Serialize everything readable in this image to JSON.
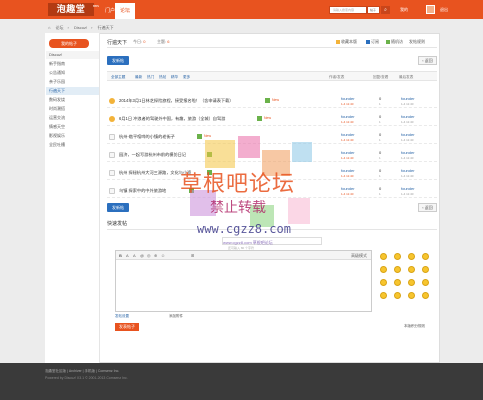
{
  "header": {
    "logo": "泡趣堂",
    "logo_sup": "BBS",
    "nav": [
      "门户",
      "论坛"
    ],
    "search_placeholder": "请输入搜索内容",
    "search_type": "帖子",
    "search_icon": "search-icon",
    "links": [
      "我的",
      "退出"
    ]
  },
  "breadcrumb": [
    "首页",
    "论坛",
    "Discuz!",
    "行遍天下"
  ],
  "sidebar": {
    "post_button": "我的帖子",
    "head": "Discuz!",
    "items": [
      "新手指南",
      "公告通知",
      "亲子乐园",
      "行遍天下",
      "数码发烧",
      "时尚潮搭",
      "运营交流",
      "情感天空",
      "影视娱乐",
      "全民吐槽"
    ],
    "active_index": 3
  },
  "main": {
    "title": "行遍天下",
    "today_label": "今日:",
    "today_count": "0",
    "topic_label": "主题:",
    "topic_count": "6",
    "right_links": [
      "收藏本版",
      "订阅",
      "随机访",
      "发帖规则"
    ],
    "new_post": "发新帖",
    "back": "返回",
    "filters": [
      "全部主题",
      "最新",
      "热门",
      "热帖",
      "精华",
      "更多"
    ],
    "col_author": "作者/发表",
    "col_replies": "回复/查看",
    "col_last": "最后发表"
  },
  "threads": [
    {
      "title": "2014年3月1日林芝探险旅程，接受报名啦！（含申请表下载）",
      "badge": true,
      "new": "New",
      "icon": "fire",
      "author": "founder",
      "date": "1-4 11:40",
      "replies": "0",
      "views": "1",
      "last": "founder",
      "last_date": "1-4 11:40"
    },
    {
      "title": "6月1日 冲浪者的驾驶外中国，有趣，旅游（全城）自驾游",
      "badge": true,
      "new": "New",
      "icon": "smile",
      "author": "founder",
      "date": "1-4 11:40",
      "replies": "0",
      "views": "1",
      "last": "founder",
      "last_date": "1-4 11:40"
    },
    {
      "title": "杭州-临平喧哗的小镇的老街子",
      "badge": true,
      "new": "New",
      "icon": "plain",
      "author": "founder",
      "date": "1-4 11:40",
      "replies": "0",
      "views": "1",
      "last": "founder",
      "last_date": "1-4 11:40"
    },
    {
      "title": "园济，一起写游杭州市前的模仿日记",
      "badge": true,
      "new": "",
      "icon": "plain",
      "author": "founder",
      "date": "1-4 11:40",
      "replies": "0",
      "views": "1",
      "last": "founder",
      "last_date": "1-4 11:40"
    },
    {
      "title": "杭州 探秘杭州大河三源路，文化与小资",
      "badge": true,
      "new": "",
      "icon": "plain",
      "author": "founder",
      "date": "1-4 11:40",
      "replies": "0",
      "views": "1",
      "last": "founder",
      "last_date": "1-4 11:40"
    },
    {
      "title": "乌镇 探索中的中外旅游地",
      "badge": true,
      "new": "",
      "icon": "plain",
      "author": "founder",
      "date": "1-4 11:40",
      "replies": "0",
      "views": "1",
      "last": "founder",
      "last_date": "1-4 11:40"
    }
  ],
  "quick_reply": {
    "title": "快速发帖",
    "subject_hint": "还可输入 80 个字符",
    "toolbar": [
      "B",
      "A",
      "A",
      "@",
      "◎",
      "⊕",
      "☺",
      "⊞"
    ],
    "mode": "高级模式",
    "bottom_left": "发帖设置",
    "bottom_mid": "添加附件",
    "submit": "发表帖子",
    "bottom_right": "本版积分规则"
  },
  "footer": {
    "line1": "泡趣堂社区版 | Archiver | 手机版 | Comsenz Inc.",
    "line2": "Powered by Discuz! X3.1 © 2001-2013 Comsenz Inc."
  },
  "watermark": {
    "line1": "草根吧论坛",
    "line2": "禁止转载",
    "line3": "www.cgzz8.com",
    "line4": "www.cgzz8.com 草根吧论坛"
  },
  "colors": {
    "accent": "#e8531f",
    "link": "#2b66a8",
    "button_blue": "#2b6fbe"
  }
}
